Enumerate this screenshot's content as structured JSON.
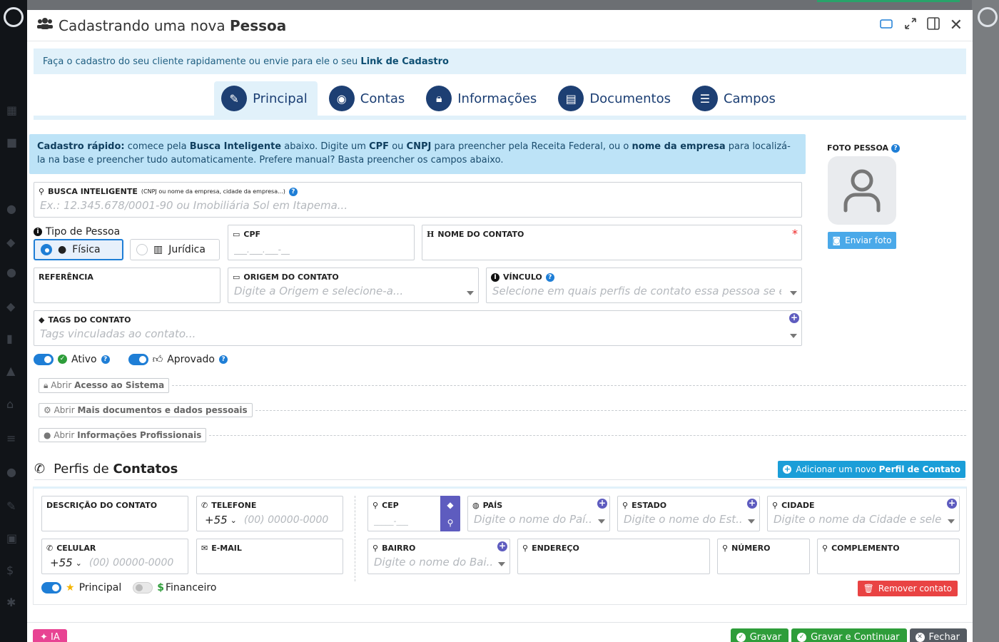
{
  "modal": {
    "title_prefix": "Cadastrando uma nova",
    "title_bold": "Pessoa",
    "info_text": "Faça o cadastro do seu cliente rapidamente ou envie para ele o seu",
    "info_link": "Link de Cadastro"
  },
  "tabs": [
    {
      "label": "Principal"
    },
    {
      "label": "Contas"
    },
    {
      "label": "Informações"
    },
    {
      "label": "Documentos"
    },
    {
      "label": "Campos"
    }
  ],
  "quick_info": {
    "lead": "Cadastro rápido:",
    "t1": "comece pela",
    "b1": "Busca Inteligente",
    "t2": "abaixo. Digite um",
    "b2": "CPF",
    "t3": "ou",
    "b3": "CNPJ",
    "t4": "para preencher pela Receita Federal, ou o",
    "b4": "nome da empresa",
    "t5": "para localizá-la na base e preencher tudo automaticamente. Prefere manual? Basta preencher os campos abaixo."
  },
  "busca": {
    "label": "BUSCA INTELIGENTE",
    "note": "(CNPJ ou nome da empresa, cidade da empresa...)",
    "placeholder": "Ex.: 12.345.678/0001-90 ou Imobiliária Sol em Itapema..."
  },
  "tipo_pessoa": {
    "label": "Tipo de Pessoa",
    "fisica": "Física",
    "juridica": "Jurídica"
  },
  "cpf": {
    "label": "CPF",
    "mask": "___.___.___-__"
  },
  "nome_contato": {
    "label": "NOME DO CONTATO",
    "required": "*"
  },
  "referencia": {
    "label": "REFERÊNCIA"
  },
  "origem": {
    "label": "ORIGEM DO CONTATO",
    "placeholder": "Digite a Origem e selecione-a..."
  },
  "vinculo": {
    "label": "VÍNCULO",
    "placeholder": "Selecione em quais perfis de contato essa pessoa se en..."
  },
  "tags": {
    "label": "TAGS DO CONTATO",
    "placeholder": "Tags vinculadas ao contato..."
  },
  "toggles": {
    "ativo": "Ativo",
    "aprovado": "Aprovado"
  },
  "expanders": {
    "acesso_pre": "Abrir",
    "acesso_bold": "Acesso ao Sistema",
    "docs_pre": "Abrir",
    "docs_bold": "Mais documentos e dados pessoais",
    "prof_pre": "Abrir",
    "prof_bold": "Informações Profissionais"
  },
  "perfis": {
    "title_pre": "Perfis de",
    "title_bold": "Contatos",
    "add_pre": "Adicionar um novo",
    "add_bold": "Perfil de Contato"
  },
  "contact": {
    "descricao": "DESCRIÇÃO DO CONTATO",
    "telefone": "TELEFONE",
    "ddi": "+55",
    "phone_placeholder": "(00) 00000-0000",
    "celular": "CELULAR",
    "email": "E-MAIL",
    "cep": "CEP",
    "cep_mask": "_____-___",
    "pais": "PAÍS",
    "pais_ph": "Digite o nome do Paí...",
    "estado": "ESTADO",
    "estado_ph": "Digite o nome do Est...",
    "cidade": "CIDADE",
    "cidade_ph": "Digite o nome da Cidade e sele...",
    "bairro": "BAIRRO",
    "bairro_ph": "Digite o nome do Bai...",
    "endereco": "ENDEREÇO",
    "numero": "NÚMERO",
    "complemento": "COMPLEMENTO",
    "principal": "Principal",
    "financeiro": "Financeiro",
    "remover": "Remover contato"
  },
  "photo": {
    "label": "FOTO PESSOA",
    "send": "Enviar foto"
  },
  "footer": {
    "ia": "IA",
    "gravar": "Gravar",
    "gravar_continuar": "Gravar e Continuar",
    "fechar": "Fechar"
  },
  "colors": {
    "accent": "#1e7ed6",
    "brand_navy": "#1d3f73",
    "success": "#2e9d3a",
    "danger": "#e94343",
    "purple": "#5e5cbf"
  }
}
